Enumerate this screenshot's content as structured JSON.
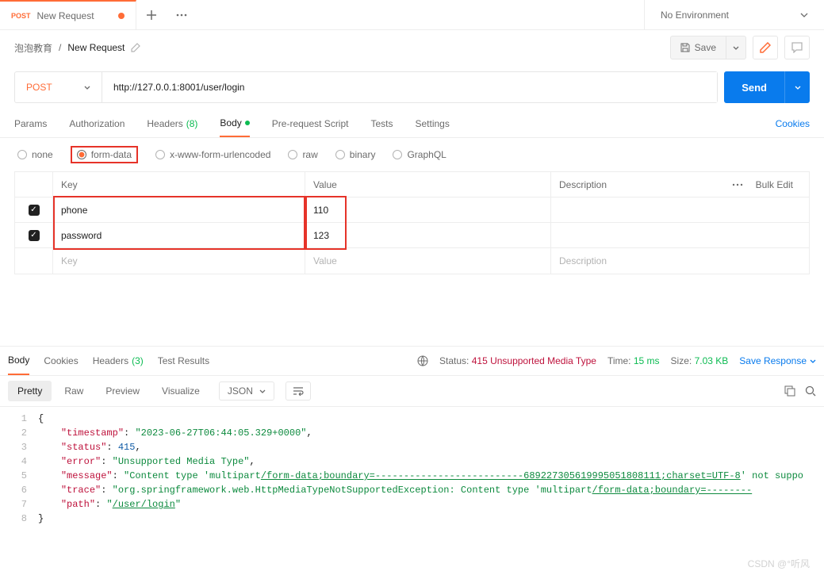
{
  "tab": {
    "method": "POST",
    "title": "New Request"
  },
  "env": {
    "label": "No Environment"
  },
  "breadcrumb": {
    "parent": "泡泡教育",
    "current": "New Request"
  },
  "actions": {
    "save": "Save"
  },
  "request": {
    "method": "POST",
    "url": "http://127.0.0.1:8001/user/login",
    "send": "Send"
  },
  "reqTabs": {
    "params": "Params",
    "auth": "Authorization",
    "headers": "Headers",
    "headers_count": "(8)",
    "body": "Body",
    "prerequest": "Pre-request Script",
    "tests": "Tests",
    "settings": "Settings",
    "cookies": "Cookies"
  },
  "bodyTypes": {
    "none": "none",
    "formdata": "form-data",
    "urlencoded": "x-www-form-urlencoded",
    "raw": "raw",
    "binary": "binary",
    "graphql": "GraphQL"
  },
  "table": {
    "header": {
      "key": "Key",
      "value": "Value",
      "description": "Description",
      "bulk": "Bulk Edit"
    },
    "rows": [
      {
        "key": "phone",
        "value": "110"
      },
      {
        "key": "password",
        "value": "123"
      }
    ],
    "placeholder": {
      "key": "Key",
      "value": "Value",
      "description": "Description"
    }
  },
  "respTabs": {
    "body": "Body",
    "cookies": "Cookies",
    "headers": "Headers",
    "headers_count": "(3)",
    "tests": "Test Results"
  },
  "respMeta": {
    "status_label": "Status:",
    "status_value": "415 Unsupported Media Type",
    "time_label": "Time:",
    "time_value": "15 ms",
    "size_label": "Size:",
    "size_value": "7.03 KB",
    "save": "Save Response"
  },
  "viewBar": {
    "pretty": "Pretty",
    "raw": "Raw",
    "preview": "Preview",
    "visualize": "Visualize",
    "format": "JSON"
  },
  "json": {
    "timestamp_k": "\"timestamp\"",
    "timestamp_v": "\"2023-06-27T06:44:05.329+0000\"",
    "status_k": "\"status\"",
    "status_v": "415",
    "error_k": "\"error\"",
    "error_v": "\"Unsupported Media Type\"",
    "message_k": "\"message\"",
    "message_v1": "\"Content type 'multipart",
    "message_v2": "/form-data;boundary=--------------------------689227305619995051808111;charset=UTF-8",
    "message_v3": "' not suppo",
    "trace_k": "\"trace\"",
    "trace_v1": "\"org.springframework.web.HttpMediaTypeNotSupportedException: Content type 'multipart",
    "trace_v2": "/form-data;boundary=--------",
    "path_k": "\"path\"",
    "path_v": "\"",
    "path_link": "/user/login",
    "path_end": "\""
  },
  "watermark": "CSDN @°听风"
}
